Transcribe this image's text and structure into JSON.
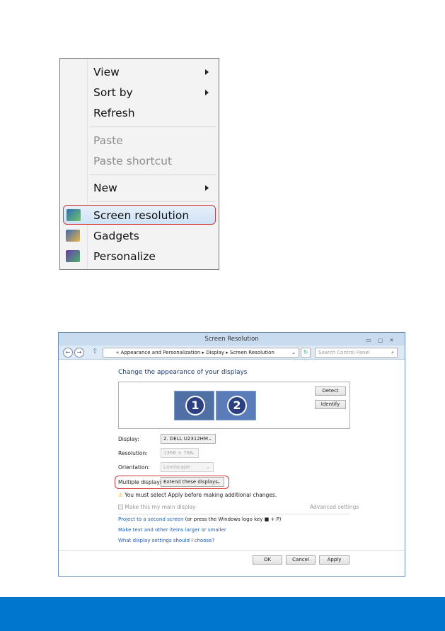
{
  "context_menu": {
    "items": [
      {
        "label": "View",
        "submenu": true,
        "enabled": true
      },
      {
        "label": "Sort by",
        "submenu": true,
        "enabled": true
      },
      {
        "label": "Refresh",
        "enabled": true
      },
      {
        "label": "Paste",
        "enabled": false
      },
      {
        "label": "Paste shortcut",
        "enabled": false
      },
      {
        "label": "New",
        "submenu": true,
        "enabled": true
      },
      {
        "label": "Screen resolution",
        "enabled": true,
        "highlighted": true,
        "icon": "monitor-icon"
      },
      {
        "label": "Gadgets",
        "enabled": true,
        "icon": "gadgets-icon"
      },
      {
        "label": "Personalize",
        "enabled": true,
        "icon": "personalize-icon"
      }
    ]
  },
  "window": {
    "title": "Screen Resolution",
    "breadcrumb": [
      "«",
      "Appearance and Personalization",
      "Display",
      "Screen Resolution"
    ],
    "search_placeholder": "Search Control Panel",
    "heading": "Change the appearance of your displays",
    "monitors": [
      "1",
      "2"
    ],
    "detect": "Detect",
    "identify": "Identify",
    "display_label": "Display:",
    "display_value": "2. DELL U2312HM",
    "resolution_label": "Resolution:",
    "resolution_value": "1366 × 768",
    "orientation_label": "Orientation:",
    "orientation_value": "Landscape",
    "multiple_label": "Multiple displays:",
    "multiple_value": "Extend these displays",
    "warning": "You must select Apply before making additional changes.",
    "main_display": "Make this my main display",
    "advanced": "Advanced settings",
    "link1": "Project to a second screen",
    "link1_suffix": "(or press the Windows logo key",
    "link1_end": "+ P)",
    "link2": "Make text and other items larger or smaller",
    "link3": "What display settings should I choose?",
    "ok": "OK",
    "cancel": "Cancel",
    "apply": "Apply"
  },
  "colors": {
    "footer": "#0076ce",
    "highlight_outline": "#d53a3a"
  }
}
